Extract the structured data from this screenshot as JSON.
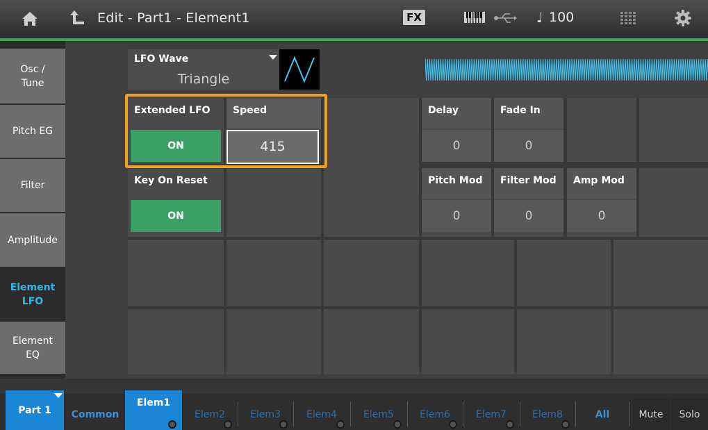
{
  "header": {
    "title": "Edit - Part1 - Element1",
    "fx_badge": "FX",
    "tempo_symbol": "♩",
    "tempo": "100",
    "icons": [
      "home-icon",
      "back-icon",
      "keyboard-icon",
      "usb-icon",
      "grid-icon",
      "gear-icon"
    ]
  },
  "sidebar": {
    "items": [
      {
        "label": "Osc /\nTune"
      },
      {
        "label": "Pitch EG"
      },
      {
        "label": "Filter"
      },
      {
        "label": "Amplitude"
      },
      {
        "label": "Element\nLFO",
        "active": true
      },
      {
        "label": "Element\nEQ"
      }
    ]
  },
  "lfo_wave": {
    "label": "LFO Wave",
    "value": "Triangle"
  },
  "params": {
    "extended_lfo": {
      "label": "Extended LFO",
      "value": "ON"
    },
    "speed": {
      "label": "Speed",
      "value": "415"
    },
    "key_on_reset": {
      "label": "Key On Reset",
      "value": "ON"
    },
    "delay": {
      "label": "Delay",
      "value": "0"
    },
    "fade_in": {
      "label": "Fade In",
      "value": "0"
    },
    "pitch_mod": {
      "label": "Pitch Mod",
      "value": "0"
    },
    "filter_mod": {
      "label": "Filter Mod",
      "value": "0"
    },
    "amp_mod": {
      "label": "Amp Mod",
      "value": "0"
    }
  },
  "bottom_tabs": {
    "part": "Part 1",
    "common": "Common",
    "elements": [
      "Elem1",
      "Elem2",
      "Elem3",
      "Elem4",
      "Elem5",
      "Elem6",
      "Elem7",
      "Elem8"
    ],
    "active_element": "Elem1",
    "all": "All",
    "mute": "Mute",
    "solo": "Solo"
  },
  "colors": {
    "accent_blue": "#1c86d6",
    "on_green": "#3aa065",
    "highlight_orange": "#f0a020",
    "wave_cyan": "#3fc6f0"
  }
}
